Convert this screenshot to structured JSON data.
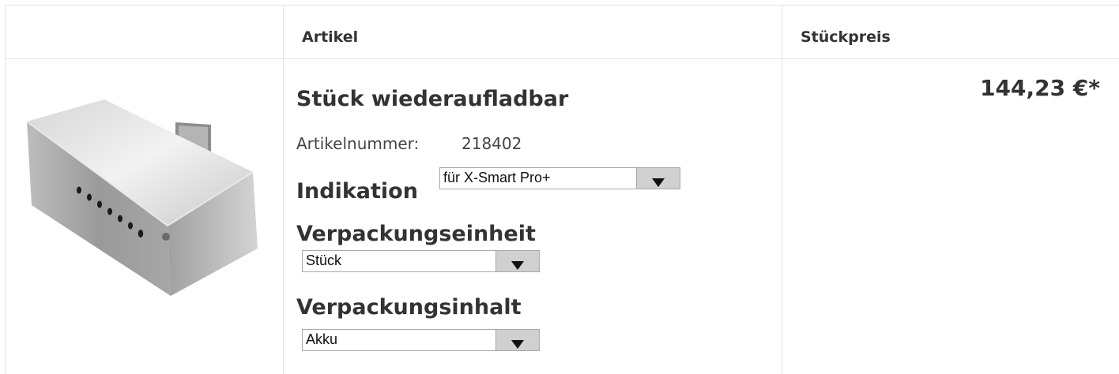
{
  "header": {
    "col_article": "Artikel",
    "col_unit_price": "Stückpreis"
  },
  "product": {
    "title": "Stück wiederaufladbar",
    "article_number_label": "Artikelnummer:",
    "article_number": "218402",
    "price": "144,23 €*",
    "image_icon": "battery-pack-image"
  },
  "options": {
    "indikation": {
      "label": "Indikation",
      "selected": "für X-Smart Pro+"
    },
    "verpackungseinheit": {
      "label": "Verpackungseinheit",
      "selected": "Stück"
    },
    "verpackungsinhalt": {
      "label": "Verpackungsinhalt",
      "selected": "Akku"
    }
  }
}
